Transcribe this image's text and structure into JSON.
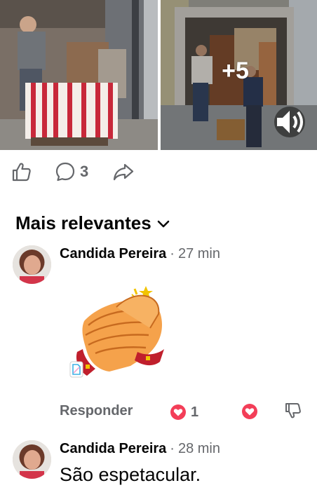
{
  "media": {
    "more_count": "+5",
    "left_photo_icon": "photo-movers-truck-left",
    "right_photo_icon": "photo-movers-truck-right",
    "sound_icon": "speaker-icon"
  },
  "actions": {
    "like_icon": "thumbs-up-icon",
    "comment_icon": "comment-bubble-icon",
    "comment_count": "3",
    "share_icon": "share-arrow-icon"
  },
  "sort": {
    "label": "Mais relevantes",
    "chevron_icon": "chevron-down-icon"
  },
  "comments": [
    {
      "author": "Candida Pereira",
      "separator": "·",
      "time": "27 min",
      "content_type": "sticker",
      "sticker_icon": "clapping-hands-sticker",
      "reply_label": "Responder",
      "reaction_count": "1",
      "reaction_color": "#f33e58"
    },
    {
      "author": "Candida Pereira",
      "separator": "·",
      "time": "28 min",
      "text": "São espetacular."
    }
  ],
  "colors": {
    "secondary_text": "#65676b",
    "love_reaction": "#f33e58"
  }
}
